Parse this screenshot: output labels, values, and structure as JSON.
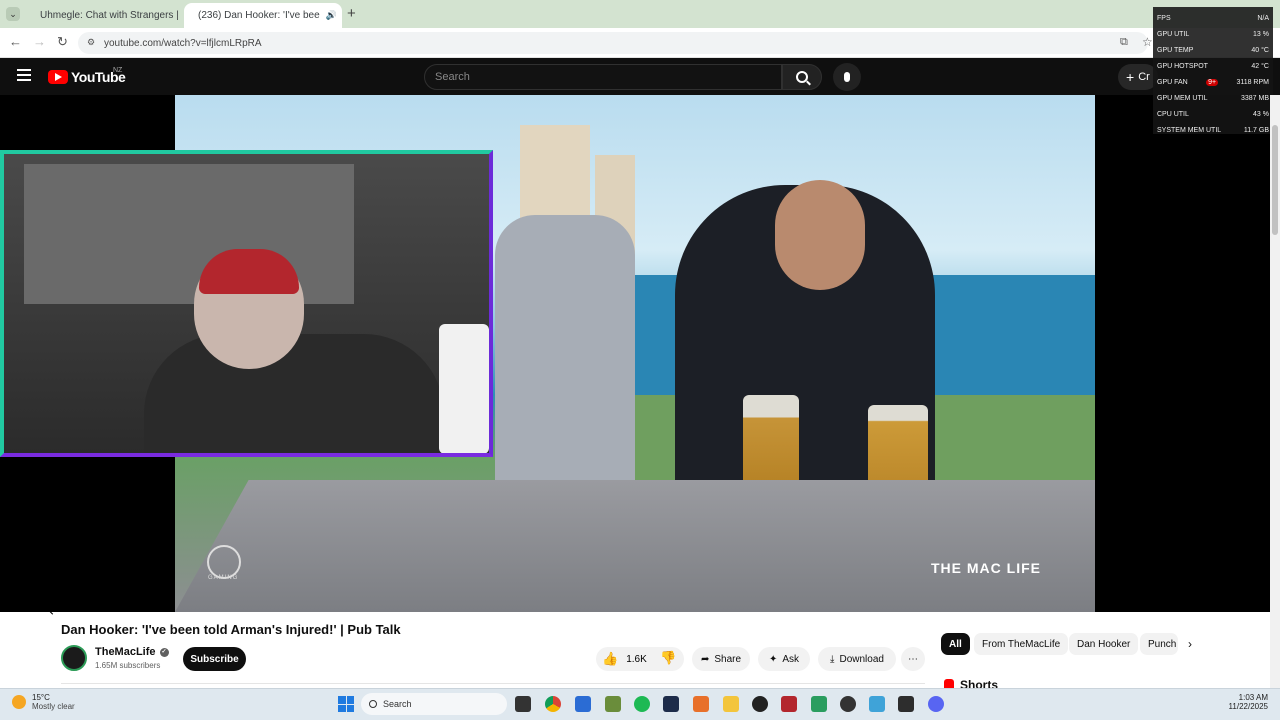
{
  "browser": {
    "tabs": [
      {
        "title": "Uhmegle: Chat with Strangers |",
        "active": false
      },
      {
        "title": "(236) Dan Hooker: 'I've bee",
        "active": true
      }
    ],
    "new_tab_label": "+",
    "url": "youtube.com/watch?v=lfjlcmLRpRA"
  },
  "youtube": {
    "logo_text": "YouTube",
    "region": "NZ",
    "search_placeholder": "Search",
    "create_label": "Cr",
    "notifications_badge": "9+"
  },
  "overlay_stats": [
    {
      "label": "FPS",
      "value": "N/A"
    },
    {
      "label": "GPU UTIL",
      "value": "13 %"
    },
    {
      "label": "GPU TEMP",
      "value": "40 °C"
    },
    {
      "label": "GPU HOTSPOT",
      "value": "42 °C"
    },
    {
      "label": "GPU FAN",
      "value": "3118 RPM"
    },
    {
      "label": "GPU MEM UTIL",
      "value": "3387 MB"
    },
    {
      "label": "CPU UTIL",
      "value": "43 %"
    },
    {
      "label": "SYSTEM MEM UTIL",
      "value": "11.7 GB"
    }
  ],
  "video": {
    "watermark": "THE MAC LIFE",
    "mic_label": "THE MAC LIFE",
    "corner_logo": "GAMING",
    "title": "Dan Hooker: 'I've been told Arman's Injured!' | Pub Talk",
    "channel": "TheMacLife",
    "subscribers": "1.65M subscribers",
    "subscribe_label": "Subscribe",
    "likes": "1.6K",
    "share_label": "Share",
    "ask_label": "Ask",
    "download_label": "Download"
  },
  "chips": [
    "All",
    "From TheMacLife",
    "Dan Hooker",
    "Punch"
  ],
  "shorts_label": "Shorts",
  "taskbar": {
    "weather_temp": "15°C",
    "weather_desc": "Mostly clear",
    "search_label": "Search",
    "time": "1:03 AM",
    "date": "11/22/2025"
  }
}
